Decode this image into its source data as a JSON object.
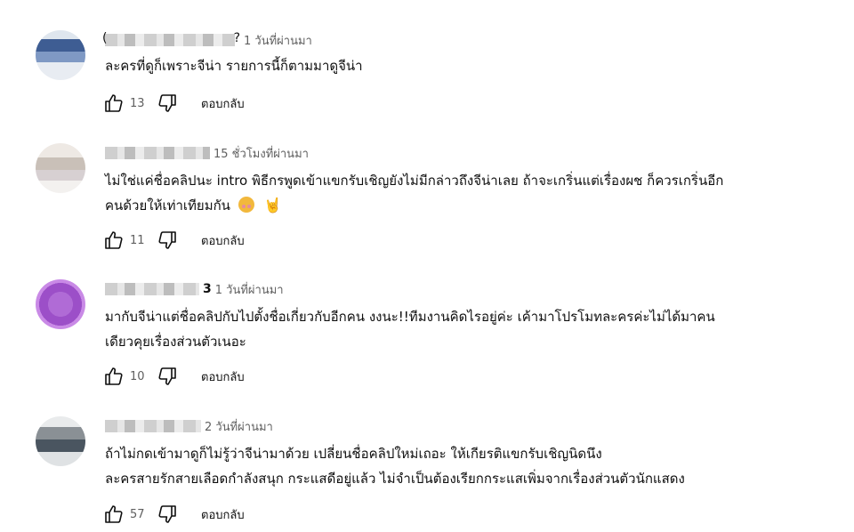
{
  "comments": [
    {
      "time": "1 วันที่ผ่านมา",
      "lines": [
        "ละครที่ดูก็เพราะจีน่า รายการนี้ก็ตามมาดูจีน่า"
      ],
      "likes": "13",
      "reply_label": "ตอบกลับ"
    },
    {
      "time": "15 ชั่วโมงที่ผ่านมา",
      "lines": [
        "ไม่ใช่แค่ชื่อคลิปนะ intro พิธีกรพูดเข้าแขกรับเชิญยังไม่มีกล่าวถึงจีน่าเลย ถ้าจะเกริ่นแต่เรื่องผช ก็ควรเกริ่นอีก",
        "คนด้วยให้เท่าเทียมกัน"
      ],
      "emoji": [
        "pleading-face-emoji",
        "rock-hand-emoji"
      ],
      "likes": "11",
      "reply_label": "ตอบกลับ"
    },
    {
      "author_suffix": "3",
      "time": "1 วันที่ผ่านมา",
      "lines": [
        "มากับจีน่าแต่ชื่อคลิปกับไปตั้งชื่อเกี่ยวกับอีกคน งงนะ!!ทีมงานคิดไรอยู่ค่ะ เค้ามาโปรโมทละครค่ะไม่ได้มาคน",
        "เดียวคุยเรื่องส่วนตัวเนอะ"
      ],
      "likes": "10",
      "reply_label": "ตอบกลับ"
    },
    {
      "time": "2 วันที่ผ่านมา",
      "lines": [
        "ถ้าไม่กดเข้ามาดูก็ไม่รู้ว่าจีน่ามาด้วย เปลี่ยนชื่อคลิปใหม่เถอะ ให้เกียรติแขกรับเชิญนิดนึง",
        "ละครสายรักสายเลือดกำลังสนุก กระแสดีอยู่แล้ว ไม่จำเป็นต้องเรียกกระแสเพิ่มจากเรื่องส่วนตัวนักแสดง"
      ],
      "likes": "57",
      "reply_label": "ตอบกลับ"
    }
  ],
  "icons": {
    "like": "thumb-up-outline-icon",
    "dislike": "thumb-down-outline-icon"
  },
  "colors": {
    "text_primary": "#0f0f0f",
    "text_secondary": "#606060"
  }
}
